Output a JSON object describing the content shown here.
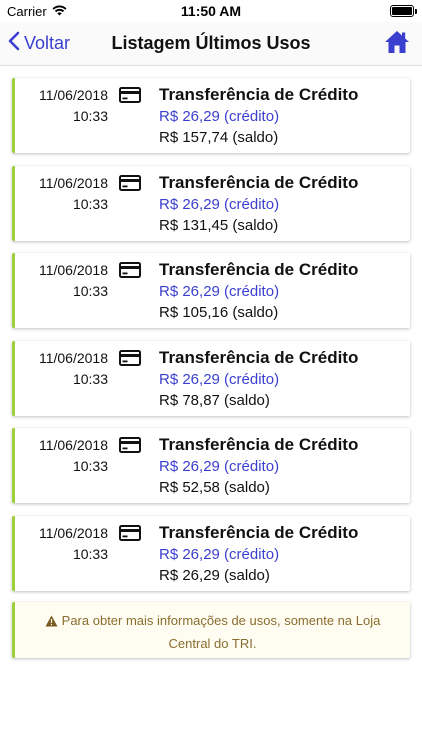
{
  "status_bar": {
    "carrier": "Carrier",
    "time": "11:50 AM"
  },
  "nav": {
    "back_label": "Voltar",
    "title": "Listagem Últimos Usos"
  },
  "entries": [
    {
      "date": "11/06/2018",
      "time": "10:33",
      "title": "Transferência de Crédito",
      "credit": "R$ 26,29 (crédito)",
      "balance": "R$ 157,74 (saldo)"
    },
    {
      "date": "11/06/2018",
      "time": "10:33",
      "title": "Transferência de Crédito",
      "credit": "R$ 26,29 (crédito)",
      "balance": "R$ 131,45 (saldo)"
    },
    {
      "date": "11/06/2018",
      "time": "10:33",
      "title": "Transferência de Crédito",
      "credit": "R$ 26,29 (crédito)",
      "balance": "R$ 105,16 (saldo)"
    },
    {
      "date": "11/06/2018",
      "time": "10:33",
      "title": "Transferência de Crédito",
      "credit": "R$ 26,29 (crédito)",
      "balance": "R$ 78,87 (saldo)"
    },
    {
      "date": "11/06/2018",
      "time": "10:33",
      "title": "Transferência de Crédito",
      "credit": "R$ 26,29 (crédito)",
      "balance": "R$ 52,58 (saldo)"
    },
    {
      "date": "11/06/2018",
      "time": "10:33",
      "title": "Transferência de Crédito",
      "credit": "R$ 26,29 (crédito)",
      "balance": "R$ 26,29 (saldo)"
    }
  ],
  "notice": {
    "text": "Para obter mais informações de usos, somente na Loja Central do TRI."
  },
  "colors": {
    "accent": "#3b3fd0",
    "card_border": "#9ed03b",
    "notice_text": "#8a6d2f"
  },
  "icons": {
    "back": "chevron-left-icon",
    "home": "home-icon",
    "card": "credit-card-icon",
    "warning": "warning-icon",
    "wifi": "wifi-icon",
    "battery": "battery-icon"
  }
}
